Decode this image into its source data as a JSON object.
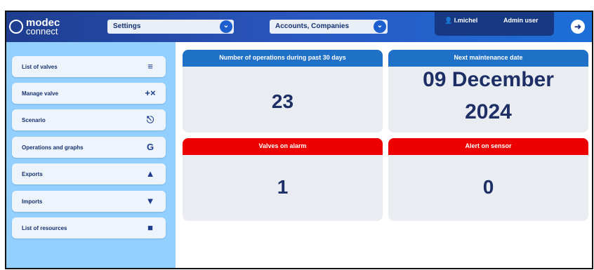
{
  "header": {
    "logo_line1": "modec",
    "logo_line2": "connect",
    "dropdown1": "Settings",
    "dropdown2": "Accounts, Companies",
    "user": "l.michel",
    "role": "Admin user"
  },
  "sidebar": {
    "items": [
      {
        "label": "List of valves",
        "icon": "list-icon"
      },
      {
        "label": "Manage valve",
        "icon": "plus-cross-icon"
      },
      {
        "label": "Scenario",
        "icon": "chair-icon"
      },
      {
        "label": "Operations and graphs",
        "icon": "refresh-g-icon"
      },
      {
        "label": "Exports",
        "icon": "export-box-icon"
      },
      {
        "label": "Imports",
        "icon": "import-box-icon"
      },
      {
        "label": "List of resources",
        "icon": "folder-icon"
      }
    ]
  },
  "cards": {
    "ops": {
      "title": "Number of operations during past 30 days",
      "value": "23"
    },
    "maint": {
      "title": "Next maintenance date",
      "line1": "09 December",
      "line2": "2024"
    },
    "alarm": {
      "title": "Valves on alarm",
      "value": "1"
    },
    "sensor": {
      "title": "Alert on sensor",
      "value": "0"
    }
  },
  "colors": {
    "header": "#1e3d8f",
    "sidebar": "#93d0ff",
    "card_blue": "#1e71c7",
    "card_red": "#ee0000"
  }
}
